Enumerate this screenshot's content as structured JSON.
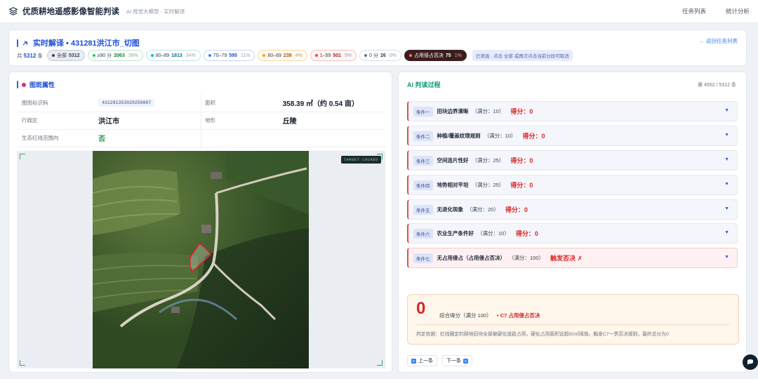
{
  "app": {
    "title": "优质耕地遥感影像智能判读",
    "subtitle": "AI 视觉大模型 · 实时解译",
    "nav": [
      "任务列表",
      "统计分析"
    ]
  },
  "header": {
    "title": "实时解译 • 431281洪江市_切图",
    "back_label": "← 返回任务列表",
    "total_prefix": "共",
    "total": "5312",
    "total_suffix": "条",
    "filters": [
      {
        "label": "全部",
        "count": "5312",
        "pct": "",
        "color": "#374151"
      },
      {
        "label": "≥90 分",
        "count": "2063",
        "pct": "39%",
        "color": "#22c55e"
      },
      {
        "label": "80–89",
        "count": "1813",
        "pct": "34%",
        "color": "#06b6d4"
      },
      {
        "label": "70–79",
        "count": "595",
        "pct": "11%",
        "color": "#3b82f6"
      },
      {
        "label": "60–69",
        "count": "239",
        "pct": "4%",
        "color": "#f59e0b"
      },
      {
        "label": "1–59",
        "count": "501",
        "pct": "9%",
        "color": "#ef4444"
      },
      {
        "label": "0 分",
        "count": "26",
        "pct": "0%",
        "color": "#6b7280"
      },
      {
        "label": "占用侵占否决",
        "count": "75",
        "pct": "1%",
        "color": "#f87171"
      }
    ],
    "hint": "已筛选 · 点击 全部 或再次点击当前分段可取消"
  },
  "attributes": {
    "section_title": "图斑属性",
    "rows": [
      {
        "k1": "图斑标识码",
        "v1": "431281353020258807",
        "k2": "面积",
        "v2": "358.39 ㎡（约 0.54 亩）"
      },
      {
        "k1": "行政区",
        "v1": "洪江市",
        "k2": "地形",
        "v2": "丘陵"
      },
      {
        "k1": "生态红线范围内",
        "v1": "否",
        "k2": "",
        "v2": ""
      }
    ],
    "map_badge": "TARGET LOCKED"
  },
  "judgement": {
    "title": "AI 判读过程",
    "count": "第 4552 / 5312 条",
    "conditions": [
      {
        "tag": "条件一",
        "name": "田块边界清晰",
        "full": "（满分：10）",
        "score": "得分：0"
      },
      {
        "tag": "条件二",
        "name": "种植/覆盖纹理规则",
        "full": "（满分：10）",
        "score": "得分：0"
      },
      {
        "tag": "条件三",
        "name": "空间连片性好",
        "full": "（满分：25）",
        "score": "得分：0"
      },
      {
        "tag": "条件四",
        "name": "地势相对平坦",
        "full": "（满分：25）",
        "score": "得分：0"
      },
      {
        "tag": "条件五",
        "name": "无退化现象",
        "full": "（满分：20）",
        "score": "得分：0"
      },
      {
        "tag": "条件六",
        "name": "农业生产条件好",
        "full": "（满分：10）",
        "score": "得分：0"
      },
      {
        "tag": "条件七",
        "name": "无占用侵占（占用侵占否决）",
        "full": "（满分：100）",
        "score": "触发否决 ✗"
      }
    ],
    "summary": {
      "score": "0",
      "label": "综合得分（满分 100）",
      "tag": "• C7 占用侵占否决",
      "reason": "判定依据：红线圈定的耕地田块全部被硬化道路占用，硬化占用面积远超50㎡阈值，触发C7一票否决规则，最终总分为0"
    },
    "prev": "上一条",
    "next": "下一条"
  },
  "icons": {
    "brand": "layers-icon",
    "section": "pin-icon",
    "expand": "chevron-down-icon",
    "fab": "chat-icon"
  }
}
